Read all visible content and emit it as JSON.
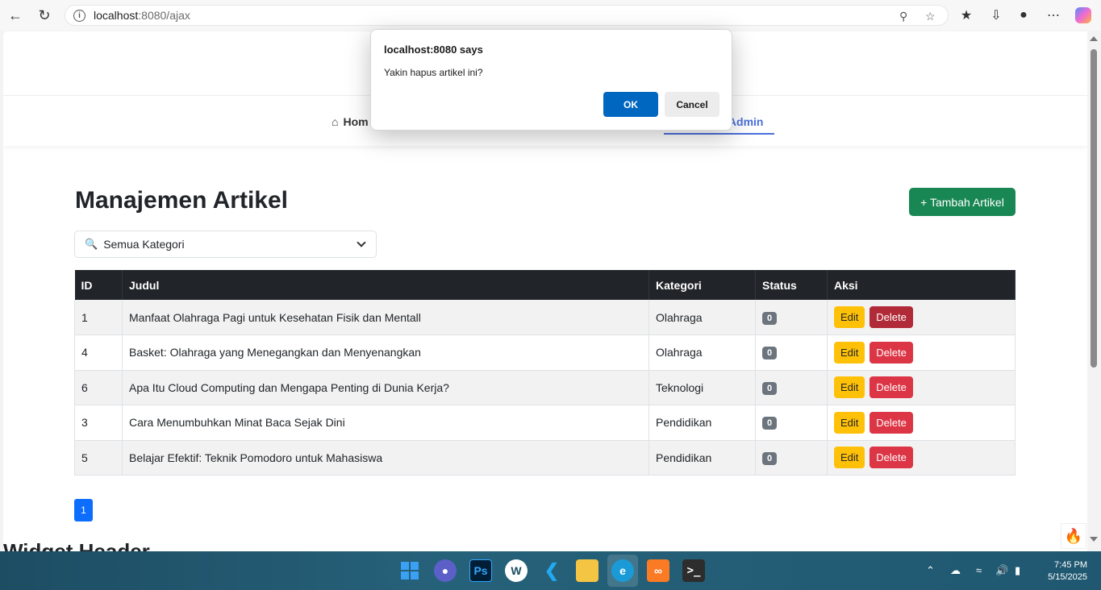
{
  "browser": {
    "url_host": "localhost",
    "url_path": ":8080/ajax"
  },
  "nav": {
    "home_label": "Hom",
    "admin_label": "d Admin"
  },
  "page": {
    "title": "Manajemen Artikel",
    "add_button": "+ Tambah Artikel",
    "filter_value": "Semua Kategori"
  },
  "table": {
    "headers": [
      "ID",
      "Judul",
      "Kategori",
      "Status",
      "Aksi"
    ],
    "rows": [
      {
        "id": "1",
        "judul": "Manfaat Olahraga Pagi untuk Kesehatan Fisik dan Mentall",
        "kategori": "Olahraga",
        "status": "0"
      },
      {
        "id": "4",
        "judul": "Basket: Olahraga yang Menegangkan dan Menyenangkan",
        "kategori": "Olahraga",
        "status": "0"
      },
      {
        "id": "6",
        "judul": "Apa Itu Cloud Computing dan Mengapa Penting di Dunia Kerja?",
        "kategori": "Teknologi",
        "status": "0"
      },
      {
        "id": "3",
        "judul": "Cara Menumbuhkan Minat Baca Sejak Dini",
        "kategori": "Pendidikan",
        "status": "0"
      },
      {
        "id": "5",
        "judul": "Belajar Efektif: Teknik Pomodoro untuk Mahasiswa",
        "kategori": "Pendidikan",
        "status": "0"
      }
    ],
    "edit_label": "Edit",
    "delete_label": "Delete"
  },
  "pagination": {
    "current": "1"
  },
  "widget_header": "Widget Header",
  "dialog": {
    "title": "localhost:8080 says",
    "message": "Yakin hapus artikel ini?",
    "ok": "OK",
    "cancel": "Cancel"
  },
  "taskbar": {
    "time": "7:45 PM",
    "date": "5/15/2025"
  },
  "colors": {
    "primary": "#0d6efd",
    "success": "#198754",
    "warning": "#ffc107",
    "danger": "#dc3545",
    "dark": "#212529",
    "nav_active": "#4a6fdc"
  }
}
